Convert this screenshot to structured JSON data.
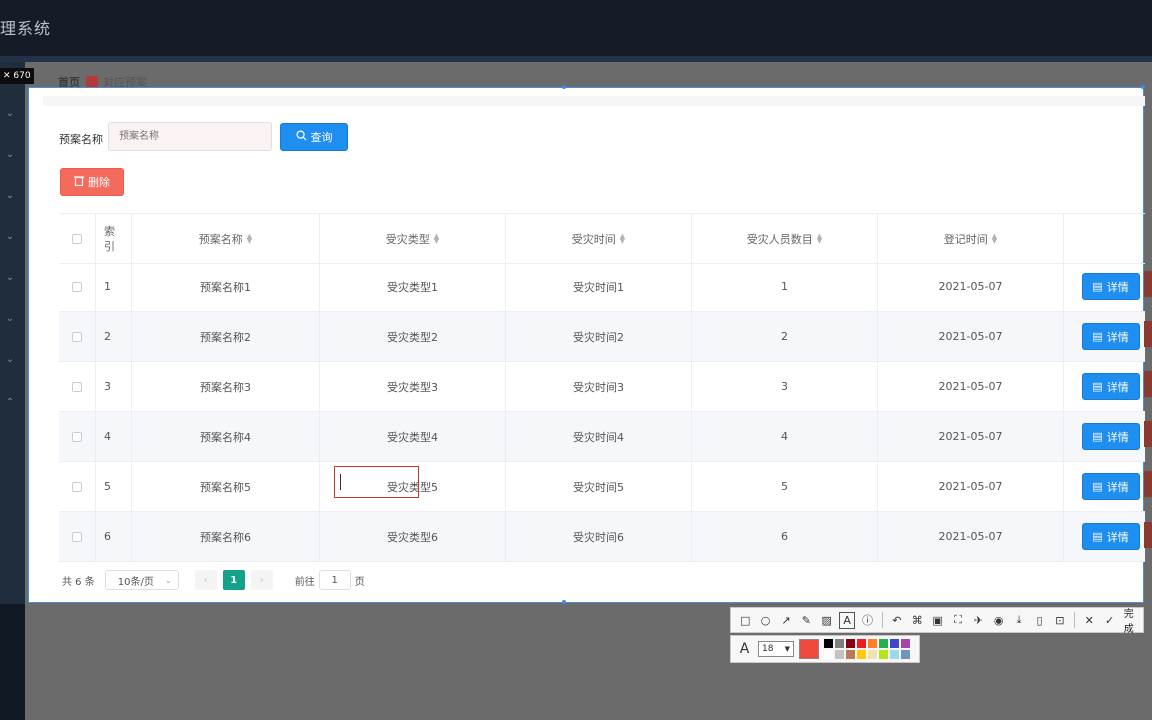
{
  "header": {
    "title": "理系统"
  },
  "overlay": {
    "size_badge": "✕ 670"
  },
  "breadcrumb": {
    "home": "首页",
    "current": "对应预案"
  },
  "search": {
    "label": "预案名称",
    "placeholder": "预案名称",
    "query_label": "查询"
  },
  "toolbar": {
    "delete_label": "删除"
  },
  "table": {
    "headers": [
      "索引",
      "预案名称",
      "受灾类型",
      "受灾时间",
      "受灾人员数目",
      "登记时间"
    ],
    "rows": [
      {
        "idx": "1",
        "name": "预案名称1",
        "type": "受灾类型1",
        "time": "受灾时间1",
        "count": "1",
        "date": "2021-05-07",
        "action": "详情"
      },
      {
        "idx": "2",
        "name": "预案名称2",
        "type": "受灾类型2",
        "time": "受灾时间2",
        "count": "2",
        "date": "2021-05-07",
        "action": "详情"
      },
      {
        "idx": "3",
        "name": "预案名称3",
        "type": "受灾类型3",
        "time": "受灾时间3",
        "count": "3",
        "date": "2021-05-07",
        "action": "详情"
      },
      {
        "idx": "4",
        "name": "预案名称4",
        "type": "受灾类型4",
        "time": "受灾时间4",
        "count": "4",
        "date": "2021-05-07",
        "action": "详情"
      },
      {
        "idx": "5",
        "name": "预案名称5",
        "type": "受灾类型5",
        "time": "受灾时间5",
        "count": "5",
        "date": "2021-05-07",
        "action": "详情"
      },
      {
        "idx": "6",
        "name": "预案名称6",
        "type": "受灾类型6",
        "time": "受灾时间6",
        "count": "6",
        "date": "2021-05-07",
        "action": "详情"
      }
    ]
  },
  "pagination": {
    "total": "共 6 条",
    "page_size": "10条/页",
    "prev": "‹",
    "current_page": "1",
    "next": "›",
    "goto_prefix": "前往",
    "goto_value": "1",
    "goto_suffix": "页"
  },
  "snip_tools": {
    "font_size": "18",
    "done_label": "完成",
    "current_color": "#f04a3c",
    "palette": [
      "#000000",
      "#7f7f7f",
      "#880015",
      "#ed1c24",
      "#ff7f27",
      "#22b14c",
      "#3f48cc",
      "#a349a4",
      "#ffffff",
      "#c3c3c3",
      "#b97a57",
      "#ffc90e",
      "#efe4b0",
      "#b5e61d",
      "#99d9ea",
      "#7092be"
    ]
  },
  "colors": {
    "primary": "#1e8ef0",
    "danger": "#f46a5c",
    "page_active": "#13a38a",
    "header_bg": "#151c28"
  }
}
